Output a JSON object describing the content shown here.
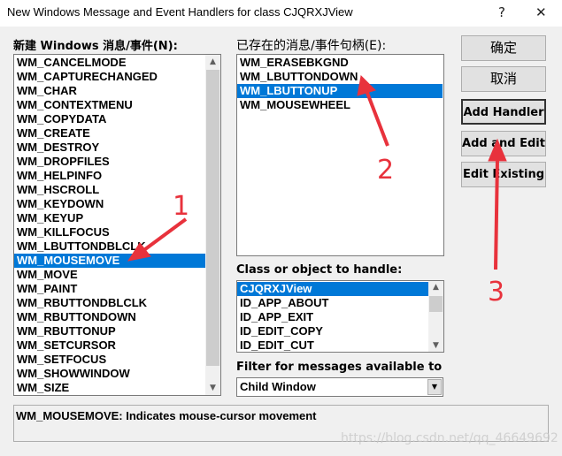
{
  "window": {
    "title": "New Windows Message and Event Handlers for class CJQRXJView",
    "help": "?",
    "close": "✕"
  },
  "new_messages": {
    "label": "新建 Windows 消息/事件(N):",
    "selected": "WM_MOUSEMOVE",
    "items": [
      "WM_CANCELMODE",
      "WM_CAPTURECHANGED",
      "WM_CHAR",
      "WM_CONTEXTMENU",
      "WM_COPYDATA",
      "WM_CREATE",
      "WM_DESTROY",
      "WM_DROPFILES",
      "WM_HELPINFO",
      "WM_HSCROLL",
      "WM_KEYDOWN",
      "WM_KEYUP",
      "WM_KILLFOCUS",
      "WM_LBUTTONDBLCLK",
      "WM_MOUSEMOVE",
      "WM_MOVE",
      "WM_PAINT",
      "WM_RBUTTONDBLCLK",
      "WM_RBUTTONDOWN",
      "WM_RBUTTONUP",
      "WM_SETCURSOR",
      "WM_SETFOCUS",
      "WM_SHOWWINDOW",
      "WM_SIZE"
    ]
  },
  "existing": {
    "label": "已存在的消息/事件句柄(E):",
    "selected": "WM_LBUTTONUP",
    "items": [
      "WM_ERASEBKGND",
      "WM_LBUTTONDOWN",
      "WM_LBUTTONUP",
      "WM_MOUSEWHEEL"
    ]
  },
  "buttons": {
    "ok": "确定",
    "cancel": "取消",
    "add_handler": "Add Handler",
    "add_and_edit": "Add and Edit",
    "edit_existing": "Edit Existing"
  },
  "class_list": {
    "label": "Class or object to handle:",
    "selected": "CJQRXJView",
    "items": [
      "CJQRXJView",
      "ID_APP_ABOUT",
      "ID_APP_EXIT",
      "ID_EDIT_COPY",
      "ID_EDIT_CUT"
    ]
  },
  "filter": {
    "label": "Filter for messages available to",
    "value": "Child Window"
  },
  "description": "WM_MOUSEMOVE:  Indicates mouse-cursor movement",
  "annotations": [
    "1",
    "2",
    "3"
  ],
  "watermark": "https://blog.csdn.net/qq_46649692",
  "colors": {
    "selection": "#0078d7",
    "annotation": "#e8323c"
  }
}
